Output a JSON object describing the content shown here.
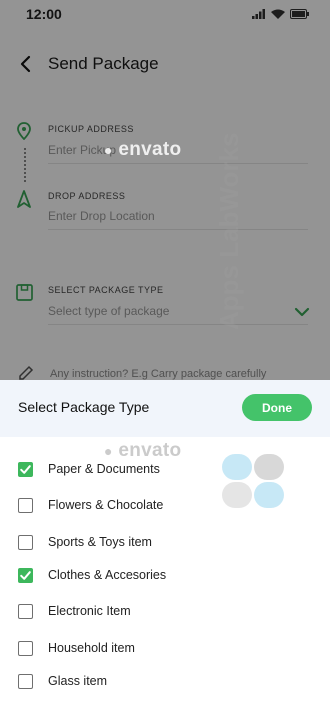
{
  "status_bar": {
    "time": "12:00"
  },
  "header": {
    "title": "Send Package"
  },
  "form": {
    "pickup_label": "PICKUP ADDRESS",
    "pickup_placeholder": "Enter Pickup",
    "drop_label": "DROP ADDRESS",
    "drop_placeholder": "Enter Drop Location",
    "package_type_label": "SELECT PACKAGE TYPE",
    "package_type_placeholder": "Select type of package",
    "instruction_placeholder": "Any instruction? E.g Carry package carefully"
  },
  "watermarks": {
    "envato_top": "envato",
    "envato_bottom": "envato",
    "vertical": "Apps LabWorks"
  },
  "sheet": {
    "title": "Select Package Type",
    "done_label": "Done",
    "options": [
      {
        "label": "Paper & Documents",
        "checked": true
      },
      {
        "label": "Flowers & Chocolate",
        "checked": false
      },
      {
        "label": "Sports & Toys item",
        "checked": false
      },
      {
        "label": "Clothes & Accesories",
        "checked": true
      },
      {
        "label": "Electronic Item",
        "checked": false
      },
      {
        "label": "Household item",
        "checked": false
      },
      {
        "label": "Glass item",
        "checked": false
      }
    ]
  },
  "colors": {
    "accent_green": "#44c36a",
    "checkbox_green": "#3db75c",
    "sheet_header_bg": "#f1f5fb"
  }
}
